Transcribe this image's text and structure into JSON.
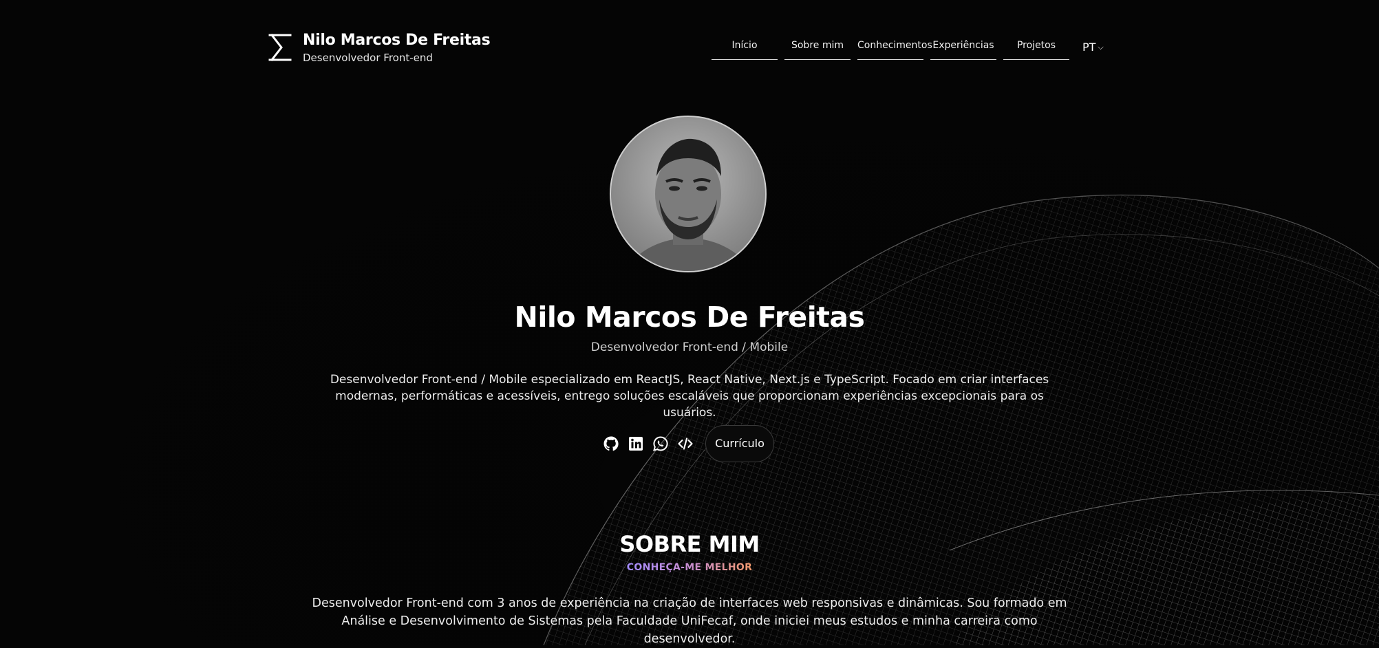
{
  "header": {
    "brand_name": "Nilo Marcos De Freitas",
    "brand_role": "Desenvolvedor Front-end",
    "nav": [
      {
        "label": "Início"
      },
      {
        "label": "Sobre mim"
      },
      {
        "label": "Conhecimentos"
      },
      {
        "label": "Experiências"
      },
      {
        "label": "Projetos"
      }
    ],
    "language": "PT"
  },
  "hero": {
    "name": "Nilo Marcos De Freitas",
    "role": "Desenvolvedor Front-end / Mobile",
    "description": "Desenvolvedor Front-end / Mobile especializado em ReactJS, React Native, Next.js e TypeScript. Focado em criar interfaces modernas, performáticas e acessíveis, entrego soluções escaláveis que proporcionam experiências excepcionais para os usuários.",
    "social_icons": [
      "github-icon",
      "linkedin-icon",
      "whatsapp-icon",
      "code-icon"
    ],
    "cv_button": "Currículo"
  },
  "about": {
    "title": "SOBRE MIM",
    "subtitle": "CONHEÇA-ME MELHOR",
    "description": "Desenvolvedor Front-end com 3 anos de experiência na criação de interfaces web responsivas e dinâmicas. Sou formado em Análise e Desenvolvimento de Sistemas pela Faculdade UniFecaf, onde iniciei meus estudos e minha carreira como desenvolvedor."
  },
  "colors": {
    "background": "#050505",
    "text": "#ffffff",
    "gradient_start": "#a48cff",
    "gradient_end": "#f39a6c"
  }
}
